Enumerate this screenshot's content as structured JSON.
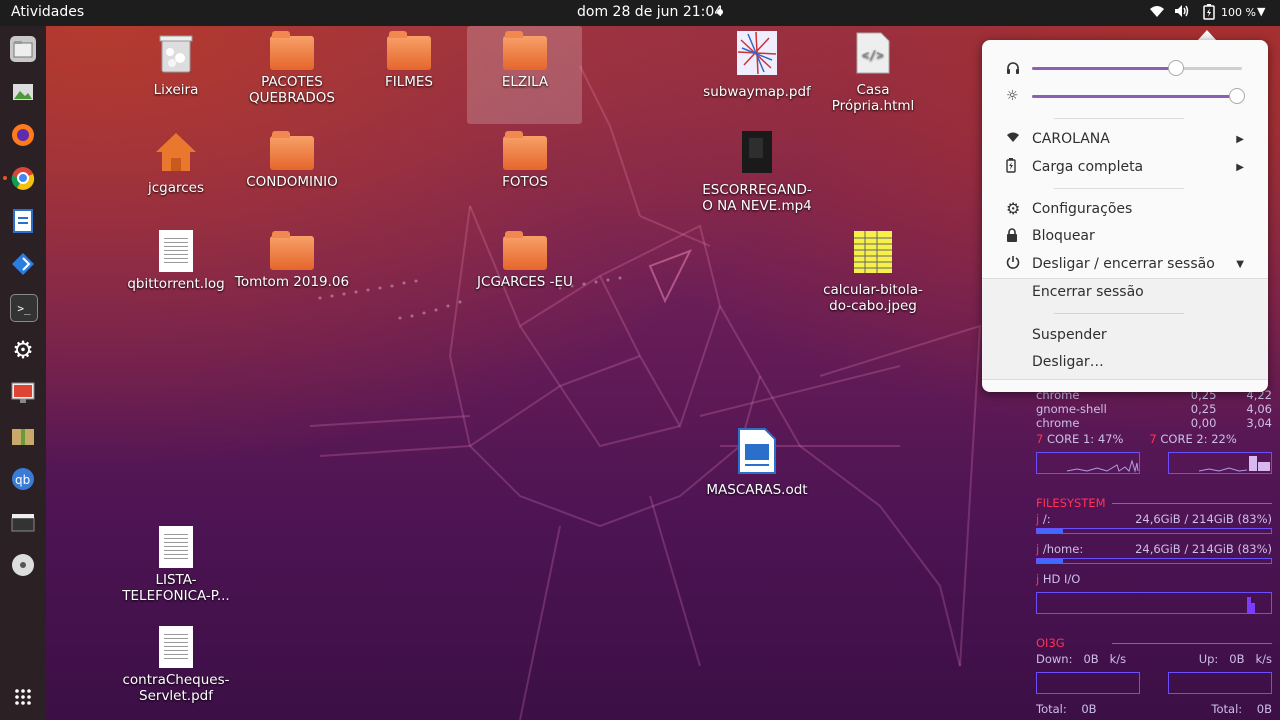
{
  "topbar": {
    "activities": "Atividades",
    "clock": "dom 28 de jun  21:04",
    "battery_percent": "100 %",
    "icons": [
      "wifi-icon",
      "volume-icon",
      "battery-icon",
      "menu-arrow-icon"
    ]
  },
  "dock": {
    "items": [
      {
        "name": "file-manager-icon",
        "running": false
      },
      {
        "name": "image-viewer-icon",
        "running": false
      },
      {
        "name": "firefox-icon",
        "running": false
      },
      {
        "name": "chrome-icon",
        "running": true
      },
      {
        "name": "libreoffice-writer-icon",
        "running": false
      },
      {
        "name": "vscode-icon",
        "running": false
      },
      {
        "name": "terminal-icon",
        "running": false
      },
      {
        "name": "settings-icon",
        "running": false
      },
      {
        "name": "screenshot-icon",
        "running": false
      },
      {
        "name": "archive-manager-icon",
        "running": false
      },
      {
        "name": "qbittorrent-icon",
        "running": false
      },
      {
        "name": "video-player-icon",
        "running": false
      },
      {
        "name": "disc-icon",
        "running": false
      }
    ],
    "app_grid": "show-applications-icon"
  },
  "desktop": {
    "icons": [
      {
        "label": "Lixeira",
        "type": "trash"
      },
      {
        "label": "PACOTES QUEBRADOS",
        "type": "folder"
      },
      {
        "label": "FILMES",
        "type": "folder"
      },
      {
        "label": "ELZILA",
        "type": "folder"
      },
      {
        "label": "subwaymap.pdf",
        "type": "map"
      },
      {
        "label": "Casa Própria.html",
        "type": "html"
      },
      {
        "label": "jcgarces",
        "type": "home"
      },
      {
        "label": "CONDOMINIO",
        "type": "folder"
      },
      {
        "label": "FOTOS",
        "type": "folder"
      },
      {
        "label": "ESCORREGAND-O NA NEVE.mp4",
        "type": "video"
      },
      {
        "label": "qbittorrent.log",
        "type": "text"
      },
      {
        "label": "Tomtom 2019.06",
        "type": "folder"
      },
      {
        "label": "JCGARCES -EU",
        "type": "folder"
      },
      {
        "label": "calcular-bitola-do-cabo.jpeg",
        "type": "spreadsheet-image"
      },
      {
        "label": "MASCARAS.odt",
        "type": "odt"
      },
      {
        "label": "LISTA-TELEFONICA-P...",
        "type": "doc"
      },
      {
        "label": "contraCheques-Servlet.pdf",
        "type": "doc"
      }
    ]
  },
  "menu": {
    "volume_level": 0.68,
    "brightness_level": 0.97,
    "wifi": "CAROLANA",
    "battery": "Carga completa",
    "settings": "Configurações",
    "lock": "Bloquear",
    "power": "Desligar / encerrar sessão",
    "logout": "Encerrar sessão",
    "suspend": "Suspender",
    "shutdown": "Desligar…"
  },
  "conky": {
    "processes": [
      {
        "name": "chrome",
        "cpu": "0,25",
        "mem": "4,22"
      },
      {
        "name": "gnome-shell",
        "cpu": "0,25",
        "mem": "4,06"
      },
      {
        "name": "chrome",
        "cpu": "0,00",
        "mem": "3,04"
      }
    ],
    "core1_num": "7",
    "core1": "CORE 1:",
    "core1_val": "47%",
    "core2_num": "7",
    "core2": "CORE 2:",
    "core2_val": "22%",
    "filesystem_title": "FILESYSTEM",
    "fs": [
      {
        "prefix": "j",
        "mount": "/:",
        "used": "24,6GiB /",
        "total": "214GiB (83%)",
        "fraction": 0.11
      },
      {
        "prefix": "j",
        "mount": "/home:",
        "used": "24,6GiB /",
        "total": "214GiB (83%)",
        "fraction": 0.11
      }
    ],
    "hd_prefix": "j",
    "hd_label": "HD   I/O",
    "net_title": "OI3G",
    "down_label": "Down:",
    "down_val": "0B",
    "down_unit": "k/s",
    "up_label": "Up:",
    "up_val": "0B",
    "up_unit": "k/s",
    "total_label": "Total:",
    "total_val": "0B",
    "total2_label": "Total:",
    "total2_val": "0B"
  }
}
